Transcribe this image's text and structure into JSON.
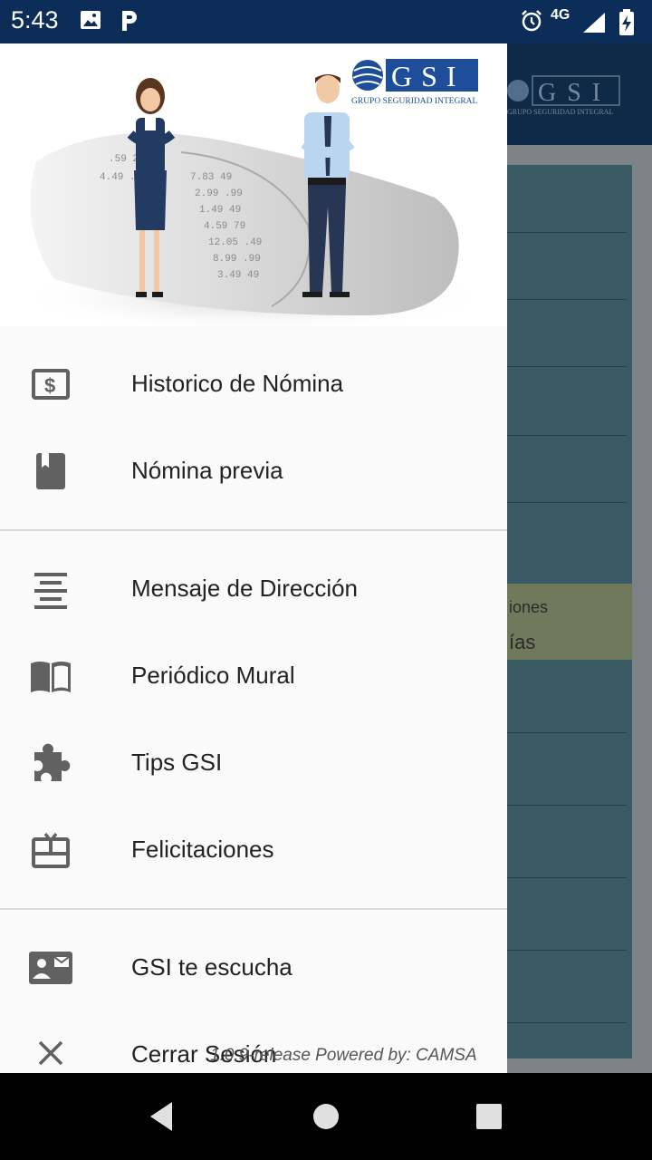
{
  "status_bar": {
    "time": "5:43",
    "network": "4G",
    "network_sub": "LTE"
  },
  "background_app": {
    "logo_text": "GSI",
    "logo_subtitle": "GRUPO SEGURIDAD INTEGRAL",
    "partial_text_1": "iones",
    "partial_text_2": "ías"
  },
  "drawer": {
    "header": {
      "logo_text": "GSI",
      "logo_subtitle": "GRUPO SEGURIDAD INTEGRAL"
    },
    "sections": [
      {
        "items": [
          {
            "label": "Historico de Nómina",
            "icon": "money-icon"
          },
          {
            "label": "Nómina previa",
            "icon": "book-icon"
          }
        ]
      },
      {
        "items": [
          {
            "label": "Mensaje de Dirección",
            "icon": "text-align-center-icon"
          },
          {
            "label": "Periódico Mural",
            "icon": "open-book-icon"
          },
          {
            "label": "Tips GSI",
            "icon": "puzzle-icon"
          },
          {
            "label": "Felicitaciones",
            "icon": "gift-card-icon"
          }
        ]
      },
      {
        "items": [
          {
            "label": "GSI te escucha",
            "icon": "contact-mail-icon"
          },
          {
            "label": "Cerrar Sesión",
            "icon": "close-icon"
          }
        ]
      }
    ],
    "footer": "1.0.9-release Powered by: CAMSA"
  },
  "colors": {
    "status_bar": "#0c2d57",
    "drawer_bg": "#fafafa",
    "icon": "#616161",
    "brand_blue": "#1e4e9a"
  }
}
